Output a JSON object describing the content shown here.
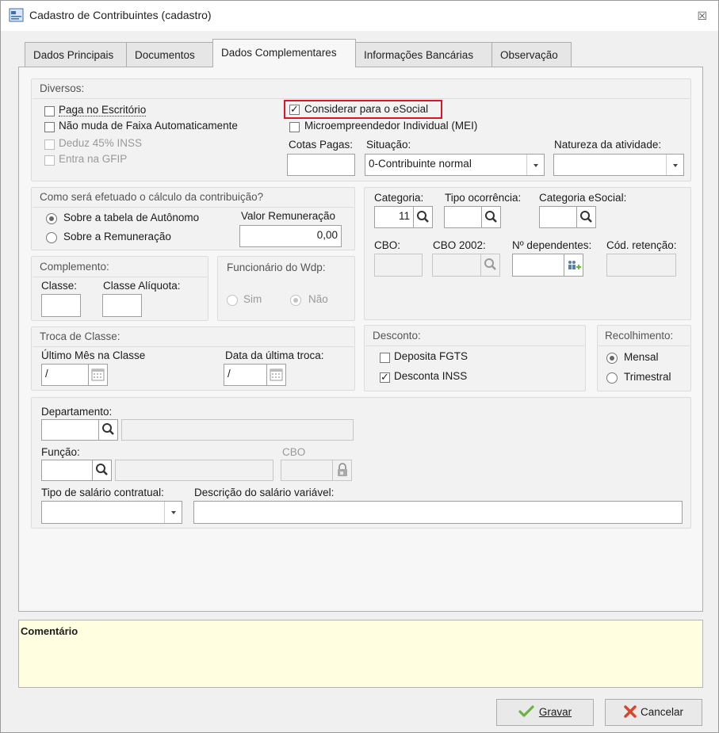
{
  "window": {
    "title": "Cadastro de Contribuintes (cadastro)",
    "close_glyph": "☒"
  },
  "tabs": [
    {
      "label": "Dados Principais"
    },
    {
      "label": "Documentos"
    },
    {
      "label": "Dados Complementares",
      "active": true
    },
    {
      "label": "Informações Bancárias"
    },
    {
      "label": "Observação"
    }
  ],
  "diversos": {
    "title": "Diversos:",
    "paga_escritorio": "Paga no Escritório",
    "nao_muda_faixa": "Não muda de Faixa Automaticamente",
    "deduz_inss": "Deduz 45% INSS",
    "entra_gfip": "Entra na GFIP",
    "considerar_esocial": "Considerar para o eSocial",
    "mei": "Microempreendedor Individual (MEI)",
    "cotas_pagas_label": "Cotas Pagas:",
    "cotas_pagas_value": "",
    "situacao_label": "Situação:",
    "situacao_value": "0-Contribuinte normal",
    "natureza_label": "Natureza da atividade:",
    "natureza_value": ""
  },
  "calculo": {
    "title": "Como será efetuado o cálculo da contribuição?",
    "opt_autonomo": "Sobre a tabela de Autônomo",
    "opt_remuneracao": "Sobre a Remuneração",
    "valor_label": "Valor Remuneração",
    "valor_value": "0,00"
  },
  "categoria": {
    "categoria_label": "Categoria:",
    "categoria_value": "11",
    "tipo_ocorrencia_label": "Tipo ocorrência:",
    "categoria_esocial_label": "Categoria eSocial:",
    "cbo_label": "CBO:",
    "cbo2002_label": "CBO 2002:",
    "dependentes_label": "Nº dependentes:",
    "cod_retencao_label": "Cód. retenção:"
  },
  "complemento": {
    "title": "Complemento:",
    "classe_label": "Classe:",
    "aliquota_label": "Classe Alíquota:"
  },
  "funcionario": {
    "title": "Funcionário do Wdp:",
    "sim": "Sim",
    "nao": "Não"
  },
  "troca": {
    "title": "Troca de Classe:",
    "ultimo_mes_label": "Último Mês na Classe",
    "ultimo_mes_value": "/",
    "data_troca_label": "Data da última troca:",
    "data_troca_value": "/"
  },
  "desconto": {
    "title": "Desconto:",
    "fgts": "Deposita FGTS",
    "inss": "Desconta INSS"
  },
  "recolhimento": {
    "title": "Recolhimento:",
    "mensal": "Mensal",
    "trimestral": "Trimestral"
  },
  "funcao": {
    "departamento_label": "Departamento:",
    "funcao_label": "Função:",
    "cbo_label": "CBO",
    "tipo_salario_label": "Tipo de salário contratual:",
    "descricao_label": "Descrição do salário variável:"
  },
  "comentario": {
    "title": "Comentário"
  },
  "buttons": {
    "gravar": "Gravar",
    "cancelar": "Cancelar"
  },
  "colors": {
    "highlight": "#e0141e",
    "comment_bg": "#fffee0",
    "checkmark_green": "#6cb33f",
    "cancel_red": "#d9462b"
  }
}
